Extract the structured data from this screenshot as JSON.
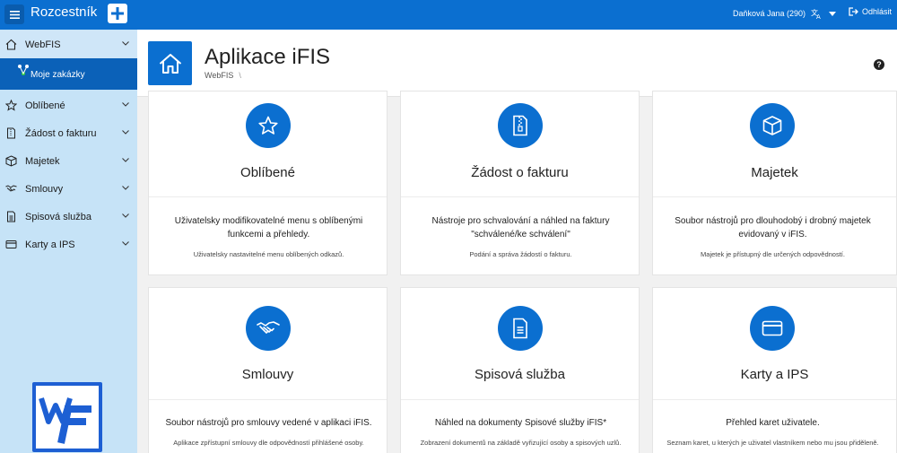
{
  "topbar": {
    "app_title": "Rozcestník",
    "user": "Daňková Jana (290)",
    "logout_label": "Odhlásit"
  },
  "sidebar": {
    "items": [
      {
        "label": "WebFIS",
        "icon": "home-icon"
      },
      {
        "label": "Moje zakázky",
        "icon": "network-icon"
      },
      {
        "label": "Oblíbené",
        "icon": "star-icon"
      },
      {
        "label": "Žádost o fakturu",
        "icon": "document-zip-icon"
      },
      {
        "label": "Majetek",
        "icon": "cube-icon"
      },
      {
        "label": "Smlouvy",
        "icon": "handshake-icon"
      },
      {
        "label": "Spisová služba",
        "icon": "file-text-icon"
      },
      {
        "label": "Karty a IPS",
        "icon": "credit-card-icon"
      }
    ]
  },
  "header": {
    "title": "Aplikace iFIS",
    "breadcrumb": "WebFIS",
    "breadcrumb_sep": "\\"
  },
  "cards": [
    {
      "title": "Oblíbené",
      "desc": "Uživatelsky modifikovatelné menu s oblíbenými funkcemi a přehledy.",
      "small": "Uživatelsky nastavitelné menu oblíbených odkazů.",
      "icon": "star-icon"
    },
    {
      "title": "Žádost o fakturu",
      "desc": "Nástroje pro schvalování a náhled na faktury \"schválené/ke schválení\"",
      "small": "Podání a správa žádostí o fakturu.",
      "icon": "document-zip-icon"
    },
    {
      "title": "Majetek",
      "desc": "Soubor nástrojů pro dlouhodobý i drobný majetek evidovaný v iFIS.",
      "small": "Majetek je přístupný dle určených odpovědností.",
      "icon": "cube-icon"
    },
    {
      "title": "Smlouvy",
      "desc": "Soubor nástrojů pro smlouvy vedené v aplikaci iFIS.",
      "small": "Aplikace zpřístupní smlouvy dle odpovědností přihlášené osoby.",
      "icon": "handshake-icon"
    },
    {
      "title": "Spisová služba",
      "desc": "Náhled na dokumenty Spisové služby iFIS*",
      "small": "Zobrazení dokumentů na základě vyřizující osoby a spisových uzlů.",
      "icon": "file-text-icon"
    },
    {
      "title": "Karty a IPS",
      "desc": "Přehled karet uživatele.",
      "small": "Seznam karet, u kterých je uživatel vlastníkem nebo mu jsou přiděleně.",
      "icon": "credit-card-icon"
    }
  ],
  "colors": {
    "brand": "#0b6fd0",
    "sidebar": "#c6e3f7",
    "sidebar_active": "#0b61b8"
  }
}
